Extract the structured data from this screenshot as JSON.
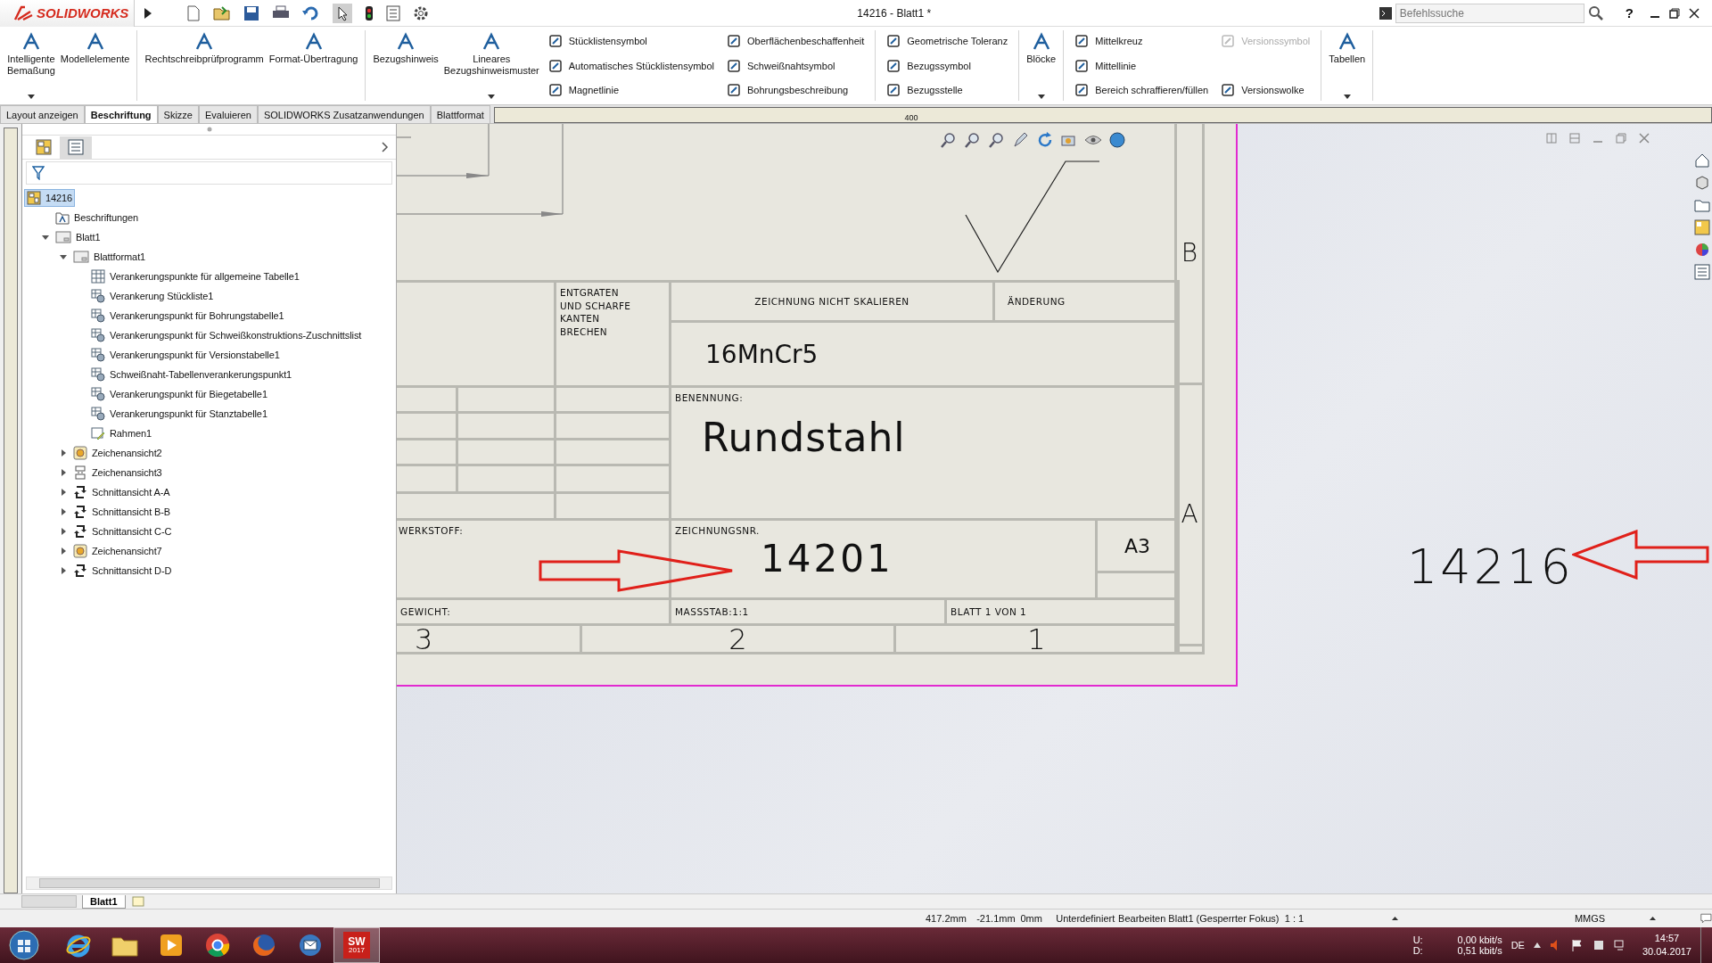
{
  "title_bar": {
    "logo": "SOLIDWORKS",
    "title": "14216 - Blatt1 *",
    "search": {
      "placeholder": "Befehlssuche"
    },
    "help": "?"
  },
  "ribbon": [
    {
      "items": [
        {
          "kind": "large",
          "label": "Intelligente\nBemaßung",
          "dropdown": true
        },
        {
          "kind": "large",
          "label": "Modellelemente",
          "dropdown": false
        }
      ]
    },
    {
      "items": [
        {
          "kind": "large",
          "label": "Rechtschreibprüfprogramm",
          "dropdown": false
        },
        {
          "kind": "large",
          "label": "Format-Übertragung",
          "dropdown": false
        }
      ]
    },
    {
      "items": [
        {
          "kind": "large",
          "label": "Bezugshinweis",
          "dropdown": false
        },
        {
          "kind": "large",
          "label": "Lineares\nBezugshinweismuster",
          "dropdown": true
        },
        {
          "kind": "column",
          "items": [
            {
              "label": "Stücklistensymbol",
              "disabled": false
            },
            {
              "label": "Automatisches Stücklistensymbol",
              "disabled": false
            },
            {
              "label": "Magnetlinie",
              "disabled": false
            }
          ]
        },
        {
          "kind": "column",
          "items": [
            {
              "label": "Oberflächenbeschaffenheit",
              "disabled": false
            },
            {
              "label": "Schweißnahtsymbol",
              "disabled": false
            },
            {
              "label": "Bohrungsbeschreibung",
              "disabled": false
            }
          ]
        }
      ]
    },
    {
      "items": [
        {
          "kind": "column",
          "items": [
            {
              "label": "Geometrische Toleranz",
              "disabled": false
            },
            {
              "label": "Bezugssymbol",
              "disabled": false
            },
            {
              "label": "Bezugsstelle",
              "disabled": false
            }
          ]
        }
      ]
    },
    {
      "items": [
        {
          "kind": "large",
          "label": "Blöcke",
          "dropdown": true
        }
      ]
    },
    {
      "items": [
        {
          "kind": "column",
          "items": [
            {
              "label": "Mittelkreuz",
              "disabled": false
            },
            {
              "label": "Mittellinie",
              "disabled": false
            },
            {
              "label": "Bereich schraffieren/füllen",
              "disabled": false
            }
          ]
        },
        {
          "kind": "column",
          "items": [
            {
              "label": "Versionssymbol",
              "disabled": true
            },
            {
              "label": "Versionswolke",
              "disabled": false
            }
          ]
        }
      ]
    },
    {
      "items": [
        {
          "kind": "large",
          "label": "Tabellen",
          "dropdown": true
        }
      ]
    }
  ],
  "tabs": [
    {
      "label": "Layout anzeigen",
      "selected": false
    },
    {
      "label": "Beschriftung",
      "selected": true
    },
    {
      "label": "Skizze",
      "selected": false
    },
    {
      "label": "Evaluieren",
      "selected": false
    },
    {
      "label": "SOLIDWORKS Zusatzanwendungen",
      "selected": false
    },
    {
      "label": "Blattformat",
      "selected": false
    }
  ],
  "ruler": {
    "label": "400"
  },
  "feature_tree": {
    "tabs": [
      {
        "kind": "tree",
        "selected": false
      },
      {
        "kind": "list",
        "selected": true
      }
    ],
    "items": [
      {
        "label": "14216",
        "kind": "drawing",
        "selected": true,
        "children": [
          {
            "label": "Beschriftungen",
            "kind": "annotations",
            "selected": false
          },
          {
            "label": "Blatt1",
            "kind": "sheet",
            "selected": false,
            "expanded": true,
            "children": [
              {
                "label": "Blattformat1",
                "kind": "sheet",
                "selected": false,
                "expanded": true,
                "children": [
                  {
                    "label": "Verankerungspunkte für allgemeine Tabelle1",
                    "kind": "table",
                    "selected": false
                  },
                  {
                    "label": "Verankerung Stückliste1",
                    "kind": "anchor",
                    "selected": false
                  },
                  {
                    "label": "Verankerungspunkt für Bohrungstabelle1",
                    "kind": "anchor",
                    "selected": false
                  },
                  {
                    "label": "Verankerungspunkt für Schweißkonstruktions-Zuschnittslist",
                    "kind": "anchor",
                    "selected": false
                  },
                  {
                    "label": "Verankerungspunkt für Versionstabelle1",
                    "kind": "anchor",
                    "selected": false
                  },
                  {
                    "label": "Schweißnaht-Tabellenverankerungspunkt1",
                    "kind": "anchor",
                    "selected": false
                  },
                  {
                    "label": "Verankerungspunkt für Biegetabelle1",
                    "kind": "anchor",
                    "selected": false
                  },
                  {
                    "label": "Verankerungspunkt für Stanztabelle1",
                    "kind": "anchor",
                    "selected": false
                  },
                  {
                    "label": "Rahmen1",
                    "kind": "frame",
                    "selected": false
                  }
                ]
              },
              {
                "label": "Zeichenansicht2",
                "kind": "view",
                "selected": false,
                "expanded": false
              },
              {
                "label": "Zeichenansicht3",
                "kind": "grid",
                "selected": false,
                "expanded": false
              },
              {
                "label": "Schnittansicht A-A",
                "kind": "section",
                "selected": false,
                "expanded": false
              },
              {
                "label": "Schnittansicht B-B",
                "kind": "section",
                "selected": false,
                "expanded": false
              },
              {
                "label": "Schnittansicht C-C",
                "kind": "section",
                "selected": false,
                "expanded": false
              },
              {
                "label": "Zeichenansicht7",
                "kind": "view",
                "selected": false,
                "expanded": false
              },
              {
                "label": "Schnittansicht D-D",
                "kind": "section",
                "selected": false,
                "expanded": false
              }
            ]
          }
        ]
      }
    ]
  },
  "sheet_tabs": [
    {
      "label": "Blatt1",
      "selected": true
    }
  ],
  "drawing": {
    "zone_rows": [
      "B",
      "A"
    ],
    "zone_columns": [
      "3",
      "2",
      "1"
    ],
    "title_block": {
      "deburr_note": "ENTGRATEN\nUND SCHARFE\nKANTEN\nBRECHEN",
      "no_scale_note": "ZEICHNUNG NICHT SKALIEREN",
      "revision_label": "ÄNDERUNG",
      "material_value": "16MnCr5",
      "name_label": "BENENNUNG:",
      "name_value": "Rundstahl",
      "material_label": "WERKSTOFF:",
      "number_label": "ZEICHNUNGSNR.",
      "number_value": "14201",
      "size": "A3",
      "weight_label": "GEWICHT:",
      "scale": "MASSSTAB:1:1",
      "sheet": "BLATT 1 VON 1"
    },
    "callout": "14216"
  },
  "status_bar": [
    {
      "text": "417.2mm",
      "dropdown": false
    },
    {
      "text": "-21.1mm",
      "dropdown": false
    },
    {
      "text": "0mm",
      "dropdown": false
    },
    {
      "text": "Unterdefiniert",
      "dropdown": false
    },
    {
      "text": "Bearbeiten Blatt1 (Gesperrter Fokus)",
      "dropdown": false
    },
    {
      "text": "1 : 1",
      "dropdown": true
    },
    {
      "text": "MMGS",
      "dropdown": true
    }
  ],
  "taskbar": {
    "apps": [
      {
        "kind": "browser-e",
        "selected": false
      },
      {
        "kind": "folder",
        "selected": false
      },
      {
        "kind": "media",
        "selected": false
      },
      {
        "kind": "chrome",
        "selected": false
      },
      {
        "kind": "firefox",
        "selected": false
      },
      {
        "kind": "mail",
        "selected": false
      },
      {
        "kind": "cad",
        "selected": true,
        "text": "SW",
        "version": "2017"
      }
    ],
    "tray": {
      "network": [
        {
          "label": "U:",
          "value": "0,00 kbit/s"
        },
        {
          "label": "D:",
          "value": "0,51 kbit/s"
        }
      ],
      "language": "DE",
      "time": "14:57",
      "date": "30.04.2017"
    }
  }
}
